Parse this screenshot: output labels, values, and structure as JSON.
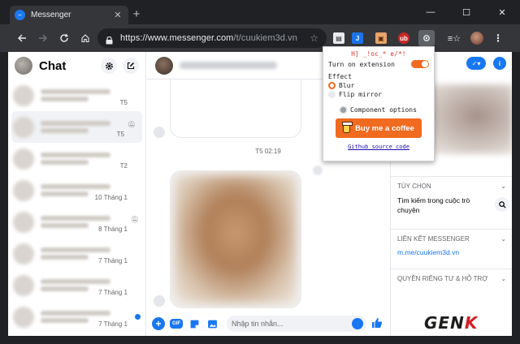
{
  "browser": {
    "tab_title": "Messenger",
    "tab_close": "✕",
    "new_tab": "+",
    "window_controls": [
      "—",
      "☐",
      "✕"
    ],
    "url_host": "https://www.messenger.com",
    "url_path": "/t/cuukiem3d.vn",
    "accent": "#1a78f2"
  },
  "sidebar": {
    "title": "Chat",
    "conversations": [
      {
        "time": "T5",
        "muted": false,
        "active": false
      },
      {
        "time": "T5",
        "muted": true,
        "active": true
      },
      {
        "time": "T2",
        "muted": false,
        "active": false
      },
      {
        "time": "10 Tháng 1",
        "muted": false,
        "active": false
      },
      {
        "time": "8 Tháng 1",
        "muted": true,
        "active": false
      },
      {
        "time": "7 Tháng 1",
        "muted": false,
        "active": false
      },
      {
        "time": "7 Tháng 1",
        "muted": false,
        "active": false
      },
      {
        "time": "7 Tháng 1",
        "muted": false,
        "active": false
      }
    ]
  },
  "chat": {
    "timestamp": "T5 02:19",
    "composer_placeholder": "Nhập tin nhắn...",
    "gif_label": "GIF"
  },
  "right_panel": {
    "options_title": "TÙY CHỌN",
    "search_item": "Tìm kiếm trong cuộc trò chuyện",
    "links_title": "LIÊN KẾT MESSENGER",
    "link": "m.me/cuukiem3d.vn",
    "privacy_title": "QUYỀN RIÊNG TƯ & HỖ TRỢ"
  },
  "popup": {
    "title": "H] _!oc_* e/*!",
    "turn_on_label": "Turn on extension",
    "turn_on": true,
    "effect_label": "Effect",
    "effects": [
      {
        "label": "Blur",
        "selected": true
      },
      {
        "label": "Flip mirror",
        "selected": false
      }
    ],
    "component_options": "Component options",
    "coffee_label": "Buy me a coffee",
    "github_label": "Github source code",
    "accent": "#f06a1f"
  },
  "watermark": {
    "main": "GEN",
    "accent": "K"
  }
}
